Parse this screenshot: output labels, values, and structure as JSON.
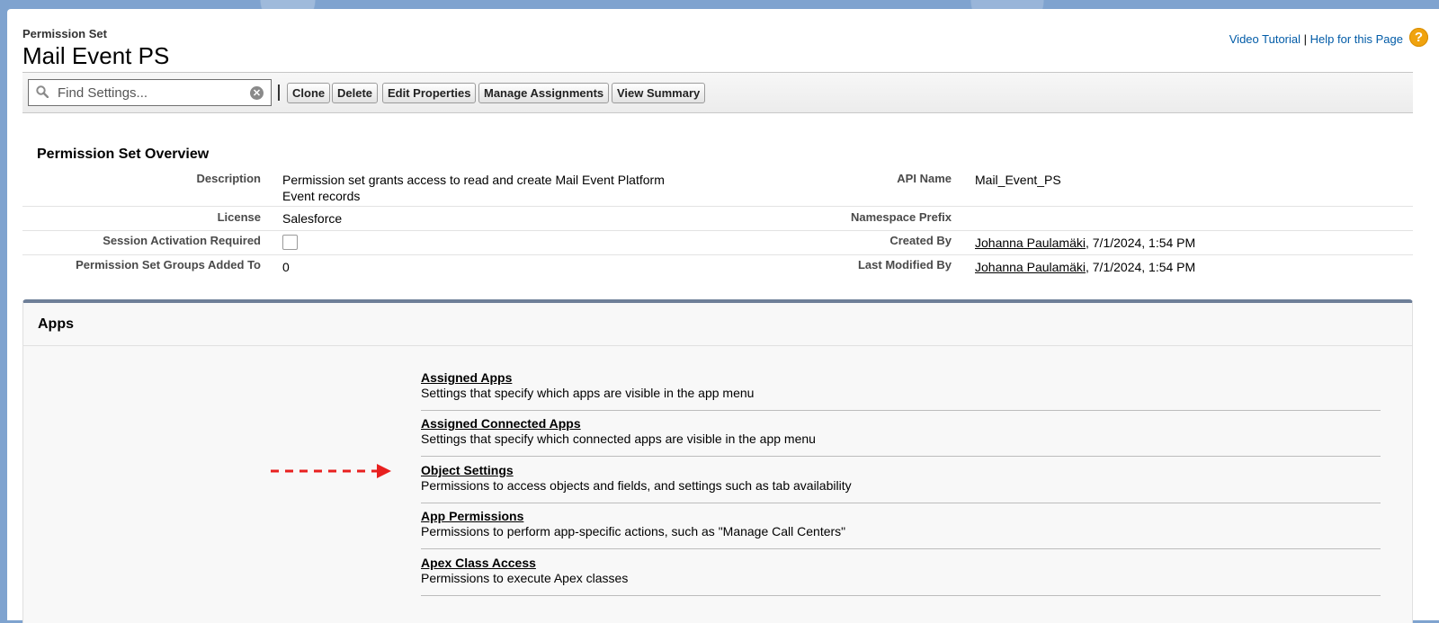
{
  "header": {
    "type_label": "Permission Set",
    "title": "Mail Event PS",
    "video_tutorial": "Video Tutorial",
    "link_separator": "|",
    "help_link": "Help for this Page",
    "help_icon": "?"
  },
  "toolbar": {
    "search_placeholder": "Find Settings...",
    "buttons": {
      "clone": "Clone",
      "delete": "Delete",
      "edit_properties": "Edit Properties",
      "manage_assignments": "Manage Assignments",
      "view_summary": "View Summary"
    }
  },
  "overview": {
    "title": "Permission Set Overview",
    "description_label": "Description",
    "description_value": "Permission set grants access to read and create Mail Event Platform Event records",
    "api_name_label": "API Name",
    "api_name_value": "Mail_Event_PS",
    "license_label": "License",
    "license_value": "Salesforce",
    "namespace_label": "Namespace Prefix",
    "session_label": "Session Activation Required",
    "created_by_label": "Created By",
    "created_by_user": "Johanna Paulamäki",
    "created_by_date": ", 7/1/2024, 1:54 PM",
    "groups_label": "Permission Set Groups Added To",
    "groups_value": "0",
    "modified_by_label": "Last Modified By",
    "modified_by_user": "Johanna Paulamäki",
    "modified_by_date": ", 7/1/2024, 1:54 PM"
  },
  "apps": {
    "title": "Apps",
    "items": [
      {
        "label": "Assigned Apps",
        "desc": "Settings that specify which apps are visible in the app menu"
      },
      {
        "label": "Assigned Connected Apps",
        "desc": "Settings that specify which connected apps are visible in the app menu"
      },
      {
        "label": "Object Settings",
        "desc": "Permissions to access objects and fields, and settings such as tab availability"
      },
      {
        "label": "App Permissions",
        "desc": "Permissions to perform app-specific actions, such as \"Manage Call Centers\""
      },
      {
        "label": "Apex Class Access",
        "desc": "Permissions to execute Apex classes"
      }
    ]
  },
  "colors": {
    "link_blue": "#015ba7",
    "arrow_red": "#e8201f",
    "apps_border": "#6e7f98"
  }
}
